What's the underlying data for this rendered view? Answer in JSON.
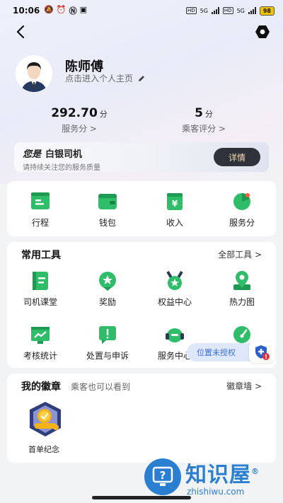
{
  "status_bar": {
    "time": "10:06",
    "icons": [
      "notification-off-icon",
      "alarm-icon",
      "nfc-icon",
      "wallet-icon"
    ],
    "network1": "HD",
    "net1_type": "5G",
    "network2": "HD",
    "net2_type": "5G",
    "battery": "98"
  },
  "profile": {
    "name": "陈师傅",
    "link_text": "点击进入个人主页"
  },
  "stats": {
    "service_score": "292.70",
    "service_unit": "分",
    "service_label": "服务分 >",
    "rating": "5",
    "rating_unit": "分",
    "rating_label": "乘客评分 >"
  },
  "level": {
    "prefix": "您是",
    "name": "白银司机",
    "subtitle": "请持续关注您的服务质量",
    "detail_button": "详情"
  },
  "quick": [
    {
      "label": "行程",
      "icon": "trip-icon"
    },
    {
      "label": "钱包",
      "icon": "wallet-icon"
    },
    {
      "label": "收入",
      "icon": "income-icon"
    },
    {
      "label": "服务分",
      "icon": "service-score-icon"
    }
  ],
  "tools": {
    "title": "常用工具",
    "all_link": "全部工具 >",
    "items": [
      {
        "label": "司机课堂",
        "icon": "classroom-icon"
      },
      {
        "label": "奖励",
        "icon": "reward-icon"
      },
      {
        "label": "权益中心",
        "icon": "benefits-icon"
      },
      {
        "label": "热力图",
        "icon": "heatmap-icon"
      },
      {
        "label": "考核统计",
        "icon": "assessment-icon"
      },
      {
        "label": "处置与申诉",
        "icon": "appeal-icon"
      },
      {
        "label": "服务中心",
        "icon": "service-center-icon"
      },
      {
        "label": "",
        "icon": "dashboard-icon"
      }
    ]
  },
  "location_tip": "位置未授权",
  "badges": {
    "title": "我的徽章",
    "subtitle": "乘客也可以看到",
    "wall_link": "徽章墙 >",
    "first_badge": "首单纪念"
  },
  "watermark": {
    "title": "知识屋",
    "registered": "®",
    "site": "zhishiwu.com"
  },
  "colors": {
    "accent_green": "#27b563",
    "dark_button": "#30323b",
    "detail_text": "#f1d9b0",
    "link_blue": "#3b6fd8"
  }
}
